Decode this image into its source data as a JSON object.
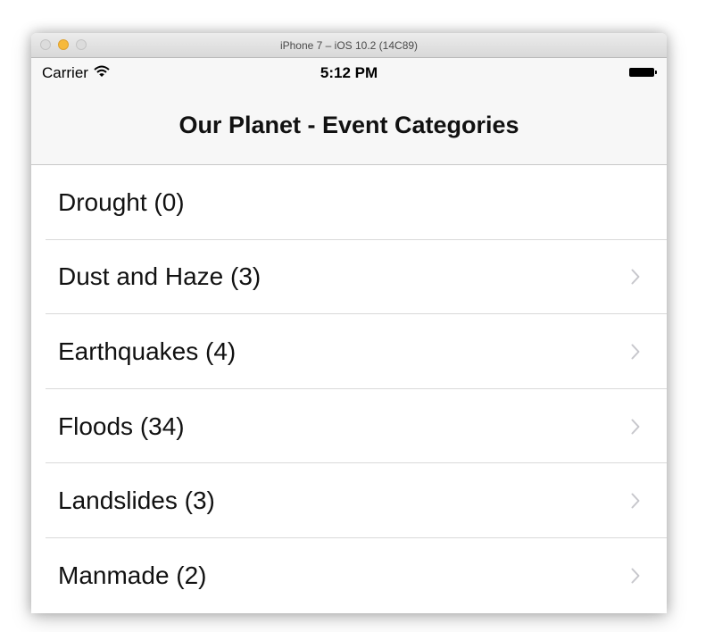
{
  "window": {
    "title": "iPhone 7 – iOS 10.2 (14C89)"
  },
  "status_bar": {
    "carrier": "Carrier",
    "time": "5:12 PM",
    "wifi_icon": "wifi-icon",
    "battery_icon": "battery-full-icon"
  },
  "nav": {
    "title": "Our Planet - Event Categories"
  },
  "categories": [
    {
      "label": "Drought (0)",
      "has_disclosure": false
    },
    {
      "label": "Dust and Haze (3)",
      "has_disclosure": true
    },
    {
      "label": "Earthquakes (4)",
      "has_disclosure": true
    },
    {
      "label": "Floods (34)",
      "has_disclosure": true
    },
    {
      "label": "Landslides (3)",
      "has_disclosure": true
    },
    {
      "label": "Manmade (2)",
      "has_disclosure": true
    }
  ],
  "colors": {
    "nav_background": "#f7f7f7",
    "separator": "#d9d9d9",
    "chevron": "#c7c7cc",
    "minimize_button": "#f6b93b"
  }
}
